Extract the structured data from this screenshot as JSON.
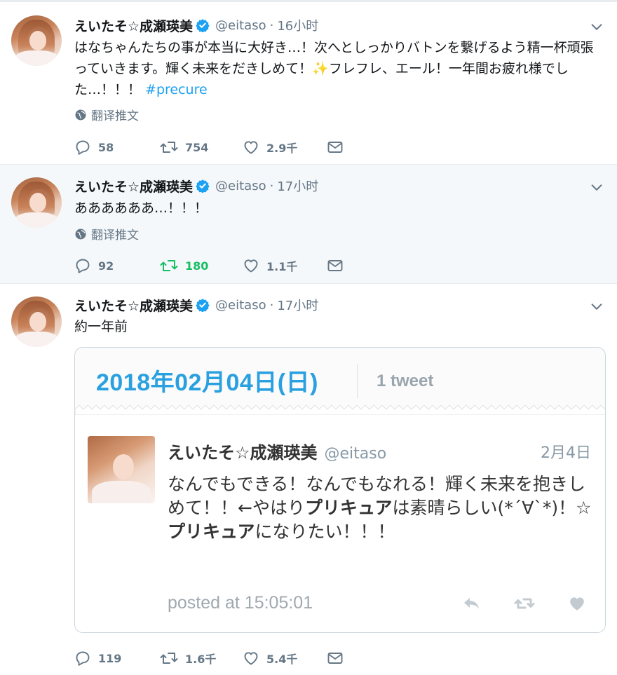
{
  "colors": {
    "text": "#14171a",
    "muted": "#657786",
    "link": "#1da1f2",
    "verified": "#1da1f2",
    "retweet_active": "#17bf63",
    "card_date": "#29a0df"
  },
  "tweets": [
    {
      "name": "えいたそ☆成瀬瑛美",
      "handle": "@eitaso",
      "time": "16小时",
      "text_main": "はなちゃんたちの事が本当に大好き…！次へとしっかりバトンを繋げるよう精一杯頑張っていきます。輝く未来をだきしめて！",
      "text_emoji": "✨",
      "text_tail": "フレフレ、エール！一年間お疲れ様でした…！！！ ",
      "hashtag": "#precure",
      "translate": "翻译推文",
      "replies": "58",
      "retweets": "754",
      "likes": "2.9千"
    },
    {
      "name": "えいたそ☆成瀬瑛美",
      "handle": "@eitaso",
      "time": "17小时",
      "text": "ああああああ…！！！",
      "translate": "翻译推文",
      "replies": "92",
      "retweets": "180",
      "likes": "1.1千"
    },
    {
      "name": "えいたそ☆成瀬瑛美",
      "handle": "@eitaso",
      "time": "17小时",
      "text": "約一年前",
      "replies": "119",
      "retweets": "1.6千",
      "likes": "5.4千"
    }
  ],
  "card": {
    "date": "2018年02月04日(日)",
    "count": "1 tweet",
    "inner": {
      "name": "えいたそ☆成瀬瑛美",
      "handle": "@eitaso",
      "date": "2月4日",
      "text_1": "なんでもできる！なんでもなれる！輝く未来を抱きしめて！！←やはり",
      "text_bold_1": "プリキュア",
      "text_2": "は素晴らしい(*´∀`*)！☆",
      "text_bold_2": "プリキュア",
      "text_3": "になりたい！！！",
      "posted": "posted at 15:05:01"
    }
  }
}
